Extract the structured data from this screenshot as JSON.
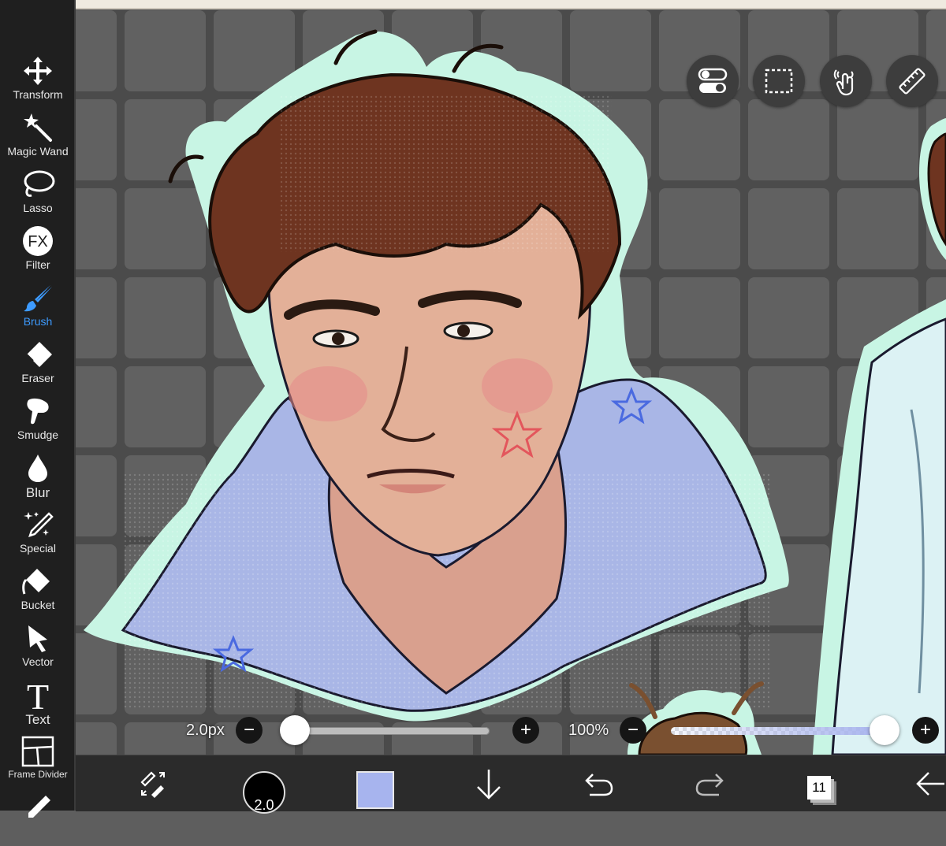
{
  "toolbar": {
    "items": [
      {
        "label": "Transform",
        "icon": "move-arrows-icon"
      },
      {
        "label": "Magic Wand",
        "icon": "magic-wand-icon"
      },
      {
        "label": "Lasso",
        "icon": "lasso-icon"
      },
      {
        "label": "Filter",
        "icon": "fx-icon"
      },
      {
        "label": "Brush",
        "icon": "brush-icon"
      },
      {
        "label": "Eraser",
        "icon": "eraser-icon"
      },
      {
        "label": "Smudge",
        "icon": "smudge-finger-icon"
      },
      {
        "label": "Blur",
        "icon": "blur-drop-icon"
      },
      {
        "label": "Special",
        "icon": "special-sparkle-pen-icon"
      },
      {
        "label": "Bucket",
        "icon": "bucket-icon"
      },
      {
        "label": "Vector",
        "icon": "vector-arrow-icon"
      },
      {
        "label": "Text",
        "icon": "text-t-icon"
      },
      {
        "label": "Frame Divider",
        "icon": "frame-divider-icon"
      }
    ],
    "active": "Brush",
    "fx_glyph": "FX",
    "text_glyph": "T"
  },
  "floating_buttons": [
    {
      "icon": "toggle-switches-icon"
    },
    {
      "icon": "selection-rectangle-icon"
    },
    {
      "icon": "touch-hand-icon"
    },
    {
      "icon": "ruler-icon"
    }
  ],
  "sliders": {
    "brush_size_label": "2.0px",
    "brush_size_fraction": 0.0,
    "opacity_label": "100%",
    "opacity_fraction": 1.0,
    "minus_glyph": "−",
    "plus_glyph": "+"
  },
  "bottom_bar": {
    "brush_size_value": "2.0",
    "current_color": "#a7b4ee",
    "layer_count": "11"
  },
  "colors": {
    "accent": "#3d9bff",
    "toolbar_bg": "#1f1f1f",
    "canvas_bg": "#5a5a5a",
    "sticker_outline": "#c8f5e4"
  }
}
